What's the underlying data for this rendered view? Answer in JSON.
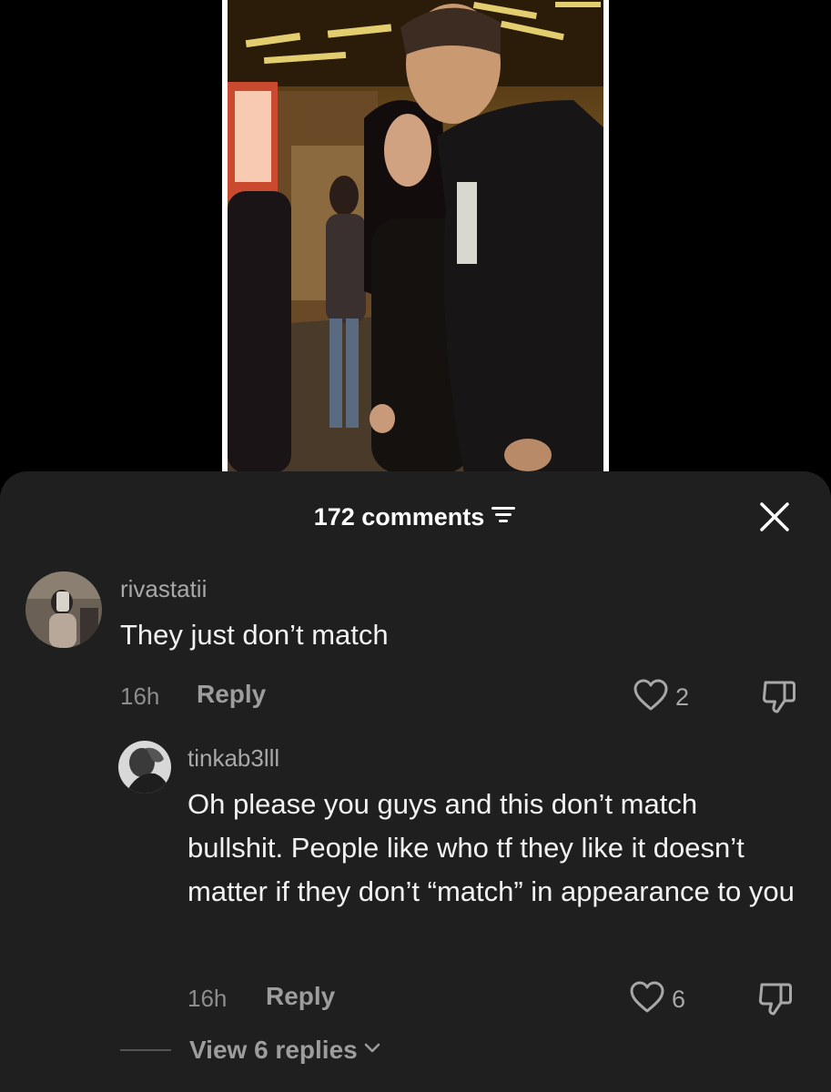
{
  "comments_header": {
    "count_label": "172 comments"
  },
  "comments": [
    {
      "username": "rivastatii",
      "text": "They just don’t match",
      "time": "16h",
      "reply_label": "Reply",
      "likes": "2"
    },
    {
      "username": "tinkab3lll",
      "text": "Oh please you guys and this don’t match bullshit. People like who tf they like it doesn’t matter if they don’t “match” in appearance to you",
      "time": "16h",
      "reply_label": "Reply",
      "likes": "6"
    }
  ],
  "view_replies_label": "View 6 replies",
  "icons": {
    "sort": "sort-icon",
    "close": "close-icon",
    "like": "heart-icon",
    "dislike": "thumbs-down-icon",
    "expand": "chevron-down-icon"
  },
  "colors": {
    "sheet_background": "#1f1f1f",
    "text_primary": "#f2f2f2",
    "text_secondary": "#a8a8a8"
  }
}
